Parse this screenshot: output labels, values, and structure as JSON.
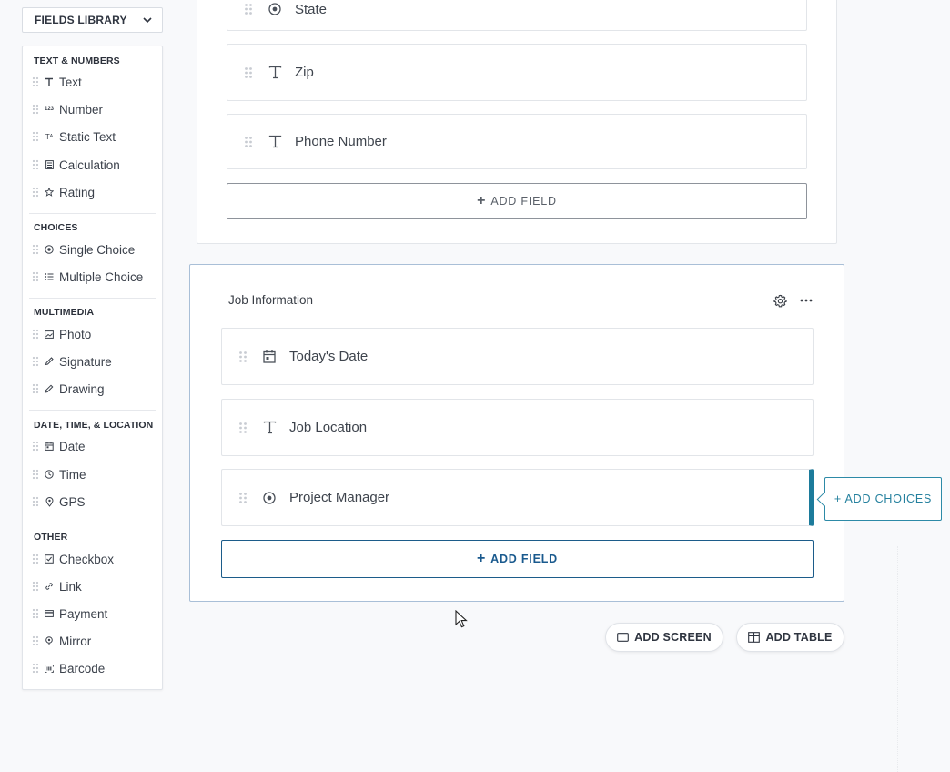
{
  "library": {
    "button_label": "FIELDS LIBRARY",
    "sections": [
      {
        "heading": "TEXT & NUMBERS",
        "items": [
          {
            "label": "Text",
            "icon": "text-icon"
          },
          {
            "label": "Number",
            "icon": "number-icon"
          },
          {
            "label": "Static Text",
            "icon": "static-text-icon"
          },
          {
            "label": "Calculation",
            "icon": "calculator-icon"
          },
          {
            "label": "Rating",
            "icon": "star-icon"
          }
        ]
      },
      {
        "heading": "CHOICES",
        "items": [
          {
            "label": "Single Choice",
            "icon": "radio-icon"
          },
          {
            "label": "Multiple Choice",
            "icon": "list-icon"
          }
        ]
      },
      {
        "heading": "MULTIMEDIA",
        "items": [
          {
            "label": "Photo",
            "icon": "photo-icon"
          },
          {
            "label": "Signature",
            "icon": "pen-icon"
          },
          {
            "label": "Drawing",
            "icon": "pencil-icon"
          }
        ]
      },
      {
        "heading": "DATE, TIME, & LOCATION",
        "items": [
          {
            "label": "Date",
            "icon": "calendar-icon"
          },
          {
            "label": "Time",
            "icon": "clock-icon"
          },
          {
            "label": "GPS",
            "icon": "location-pin-icon"
          }
        ]
      },
      {
        "heading": "OTHER",
        "items": [
          {
            "label": "Checkbox",
            "icon": "checkbox-icon"
          },
          {
            "label": "Link",
            "icon": "link-icon"
          },
          {
            "label": "Payment",
            "icon": "credit-card-icon"
          },
          {
            "label": "Mirror",
            "icon": "mirror-icon"
          },
          {
            "label": "Barcode",
            "icon": "barcode-icon"
          }
        ]
      }
    ]
  },
  "top_section": {
    "fields": [
      {
        "label": "State",
        "icon": "radio-icon"
      },
      {
        "label": "Zip",
        "icon": "text-icon"
      },
      {
        "label": "Phone Number",
        "icon": "text-icon"
      }
    ],
    "add_field_label": "ADD FIELD"
  },
  "job_section": {
    "title": "Job Information",
    "fields": [
      {
        "label": "Today's Date",
        "icon": "calendar-icon"
      },
      {
        "label": "Job Location",
        "icon": "text-icon"
      },
      {
        "label": "Project Manager",
        "icon": "radio-icon"
      }
    ],
    "add_field_label": "ADD FIELD",
    "add_choices_label": "+ ADD CHOICES"
  },
  "actions": {
    "add_screen": "ADD SCREEN",
    "add_table": "ADD TABLE"
  },
  "colors": {
    "accent": "#1c7b9b",
    "primary_blue": "#1a5a8e"
  }
}
